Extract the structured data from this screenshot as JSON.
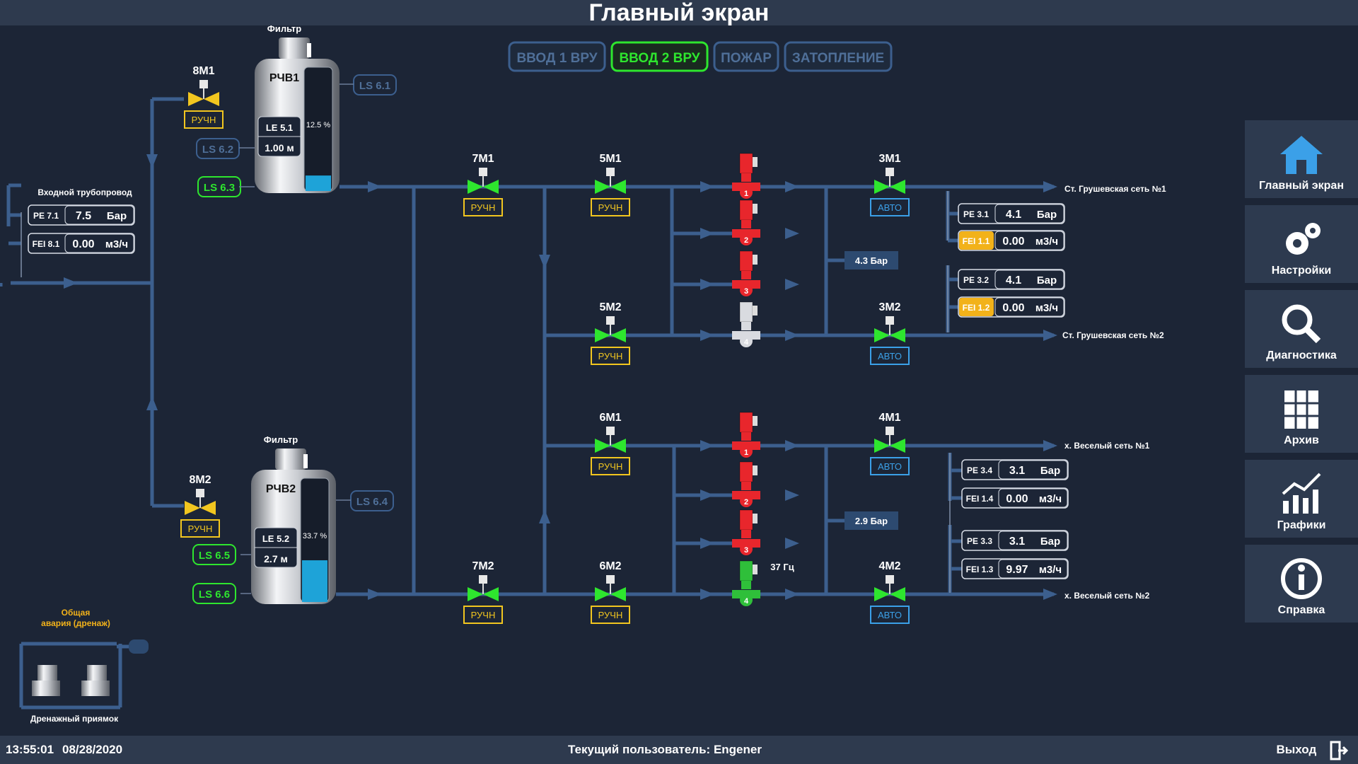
{
  "header": {
    "title": "Главный экран"
  },
  "modes": [
    {
      "label": "ВВОД 1 ВРУ",
      "active": false
    },
    {
      "label": "ВВОД 2 ВРУ",
      "active": true
    },
    {
      "label": "ПОЖАР",
      "active": false
    },
    {
      "label": "ЗАТОПЛЕНИЕ",
      "active": false
    }
  ],
  "inlet": {
    "title": "Входной трубопровод",
    "pe": {
      "tag": "PE 7.1",
      "value": "7.5",
      "unit": "Бар"
    },
    "fei": {
      "tag": "FEI 8.1",
      "value": "0.00",
      "unit": "м3/ч"
    }
  },
  "tank1": {
    "filter": "Фильтр",
    "name": "РЧВ1",
    "level_pct": 12.5,
    "level_text": "12.5 %",
    "le_tag": "LE 5.1",
    "le_value": "1.00 м",
    "ls_top": "LS 6.1",
    "ls_mid": "LS 6.2",
    "ls_bot": "LS 6.3"
  },
  "tank2": {
    "filter": "Фильтр",
    "name": "РЧВ2",
    "level_pct": 33.7,
    "level_text": "33.7 %",
    "le_tag": "LE 5.2",
    "le_value": "2.7 м",
    "ls_top": "LS 6.4",
    "ls_mid": "LS 6.5",
    "ls_bot": "LS 6.6"
  },
  "valves": {
    "v8m1": {
      "name": "8М1",
      "mode": "РУЧН"
    },
    "v8m2": {
      "name": "8М2",
      "mode": "РУЧН"
    },
    "v7m1": {
      "name": "7М1",
      "mode": "РУЧН"
    },
    "v5m1": {
      "name": "5М1",
      "mode": "РУЧН"
    },
    "v5m2": {
      "name": "5М2",
      "mode": "РУЧН"
    },
    "v3m1": {
      "name": "3М1",
      "mode": "АВТО"
    },
    "v3m2": {
      "name": "3М2",
      "mode": "АВТО"
    },
    "v6m1": {
      "name": "6М1",
      "mode": "РУЧН"
    },
    "v7m2": {
      "name": "7М2",
      "mode": "РУЧН"
    },
    "v6m2": {
      "name": "6М2",
      "mode": "РУЧН"
    },
    "v4m1": {
      "name": "4М1",
      "mode": "АВТО"
    },
    "v4m2": {
      "name": "4М2",
      "mode": "АВТО"
    }
  },
  "pumps_top": [
    {
      "num": "1",
      "state": "stopped"
    },
    {
      "num": "2",
      "state": "stopped"
    },
    {
      "num": "3",
      "state": "stopped"
    },
    {
      "num": "4",
      "state": "off"
    }
  ],
  "pumps_bottom": [
    {
      "num": "1",
      "state": "stopped"
    },
    {
      "num": "2",
      "state": "stopped"
    },
    {
      "num": "3",
      "state": "stopped"
    },
    {
      "num": "4",
      "state": "running",
      "freq": "37 Гц"
    }
  ],
  "pressure_top": "4.3 Бар",
  "pressure_bottom": "2.9 Бар",
  "outputs": {
    "o1": {
      "name": "Ст. Грушевская сеть №1",
      "pe_tag": "PE 3.1",
      "pe_value": "4.1",
      "pe_unit": "Бар",
      "fei_tag": "FEI 1.1",
      "fei_value": "0.00",
      "fei_unit": "м3/ч",
      "fei_alarm": true
    },
    "o2": {
      "name": "Ст. Грушевская сеть №2",
      "pe_tag": "PE 3.2",
      "pe_value": "4.1",
      "pe_unit": "Бар",
      "fei_tag": "FEI 1.2",
      "fei_value": "0.00",
      "fei_unit": "м3/ч",
      "fei_alarm": true
    },
    "o3": {
      "name": "х. Веселый сеть №1",
      "pe_tag": "PE 3.4",
      "pe_value": "3.1",
      "pe_unit": "Бар",
      "fei_tag": "FEI 1.4",
      "fei_value": "0.00",
      "fei_unit": "м3/ч",
      "fei_alarm": false
    },
    "o4": {
      "name": "х. Веселый сеть №2",
      "pe_tag": "PE 3.3",
      "pe_value": "3.1",
      "pe_unit": "Бар",
      "fei_tag": "FEI 1.3",
      "fei_value": "9.97",
      "fei_unit": "м3/ч",
      "fei_alarm": false
    }
  },
  "drain": {
    "alarm_line1": "Общая",
    "alarm_line2": "авария (дренаж)",
    "pit": "Дренажный приямок"
  },
  "nav": [
    {
      "label": "Главный экран",
      "icon": "home-icon"
    },
    {
      "label": "Настройки",
      "icon": "gears-icon"
    },
    {
      "label": "Диагностика",
      "icon": "magnifier-icon"
    },
    {
      "label": "Архив",
      "icon": "archive-icon"
    },
    {
      "label": "Графики",
      "icon": "chart-icon"
    },
    {
      "label": "Справка",
      "icon": "info-icon"
    }
  ],
  "footer": {
    "time": "13:55:01",
    "date": "08/28/2020",
    "user": "Текущий пользователь: Engener",
    "exit": "Выход"
  },
  "colors": {
    "pipe": "#3c5f8e",
    "bg": "#1c2536",
    "panel": "#2e3a4e",
    "green": "#2ee62e",
    "yellow": "#f2c61f",
    "red": "#e8262c",
    "auto": "#3ba0e8",
    "alarm": "#f2b21a"
  }
}
